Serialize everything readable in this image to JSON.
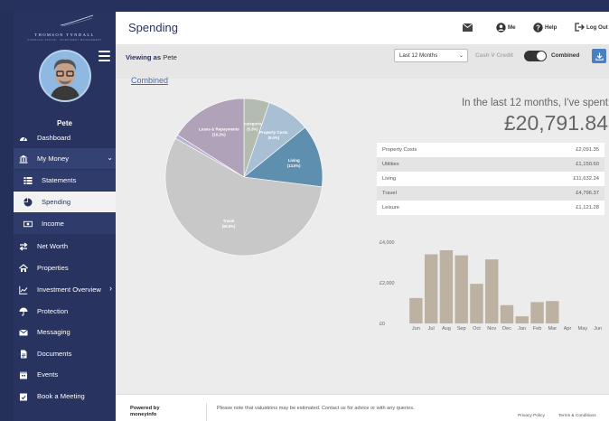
{
  "brand": {
    "name": "THOMSON TYNDALL",
    "tagline": "FINANCIAL ADVICE · INVESTMENT MANAGEMENT"
  },
  "user": {
    "name": "Pete"
  },
  "sidebar": {
    "items": [
      {
        "label": "Dashboard",
        "icon": "dashboard-icon"
      },
      {
        "label": "My Money",
        "icon": "bank-icon",
        "chevron": "⌄"
      },
      {
        "label": "Statements",
        "icon": "list-icon"
      },
      {
        "label": "Spending",
        "icon": "pie-icon"
      },
      {
        "label": "Income",
        "icon": "cash-icon"
      },
      {
        "label": "Net Worth",
        "icon": "transfer-icon"
      },
      {
        "label": "Properties",
        "icon": "home-icon"
      },
      {
        "label": "Investment Overview",
        "icon": "chart-line-icon",
        "chevron": "›"
      },
      {
        "label": "Protection",
        "icon": "umbrella-icon"
      },
      {
        "label": "Messaging",
        "icon": "envelope-icon"
      },
      {
        "label": "Documents",
        "icon": "document-icon"
      },
      {
        "label": "Events",
        "icon": "calendar-icon"
      },
      {
        "label": "Book a Meeting",
        "icon": "calendar-check-icon"
      }
    ]
  },
  "header": {
    "title": "Spending",
    "me_label": "Me",
    "help_label": "Help",
    "logout_label": "Log Out"
  },
  "toolbar": {
    "viewing_label": "Viewing as",
    "viewing_name": "Pete",
    "period_value": "Last 12 Months",
    "cash_v_credit_label": "Cash V Credit",
    "combined_label": "Combined"
  },
  "combined_link": "Combined",
  "summary": {
    "intro": "In the last 12 months, I've spent",
    "amount": "£20,791.84"
  },
  "categories": [
    {
      "name": "Property Costs",
      "amount": "£2,091.35"
    },
    {
      "name": "Utilities",
      "amount": "£1,150.60"
    },
    {
      "name": "Living",
      "amount": "£11,632.24"
    },
    {
      "name": "Travel",
      "amount": "£4,796.37"
    },
    {
      "name": "Leisure",
      "amount": "£1,121.28"
    }
  ],
  "chart_data": [
    {
      "type": "pie",
      "slices": [
        {
          "label": "Uncategorised",
          "percent": "(5.3%)",
          "value": 5.3,
          "color": "#b3bcaf"
        },
        {
          "label": "Property Costs",
          "percent": "(9.0%)",
          "value": 9.0,
          "color": "#a9bfd4"
        },
        {
          "label": "Living",
          "percent": "(13.0%)",
          "value": 13.0,
          "color": "#5e8fae"
        },
        {
          "label": "Travel",
          "percent": "(56.9%)",
          "value": 56.9,
          "color": "#c8c8c8"
        },
        {
          "label": "",
          "percent": "",
          "value": 0.8,
          "color": "#b8b2d4"
        },
        {
          "label": "Loans & Repayments",
          "percent": "(16.2%)",
          "value": 16.2,
          "color": "#b0a2b8"
        }
      ]
    },
    {
      "type": "bar",
      "categories": [
        "Jun",
        "Jul",
        "Aug",
        "Sep",
        "Oct",
        "Nov",
        "Dec",
        "Jan",
        "Feb",
        "Mar",
        "Apr",
        "May",
        "Jun"
      ],
      "values": [
        1250,
        3400,
        3600,
        3350,
        1950,
        3150,
        900,
        350,
        1050,
        1100,
        0,
        0,
        0
      ],
      "y_tick_labels": [
        "£4,000",
        "£2,000",
        "£0"
      ],
      "y_ticks": [
        4000,
        2000,
        0
      ],
      "ylim": [
        0,
        4000
      ],
      "color": "#bdb2a1"
    }
  ],
  "footer": {
    "powered_by": "Powered by",
    "powered_name": "moneyinfo",
    "note": "Please note that valuations may be estimated. Contact us for advice or with any queries.",
    "privacy": "Privacy Policy",
    "terms": "Terms & Conditions"
  }
}
